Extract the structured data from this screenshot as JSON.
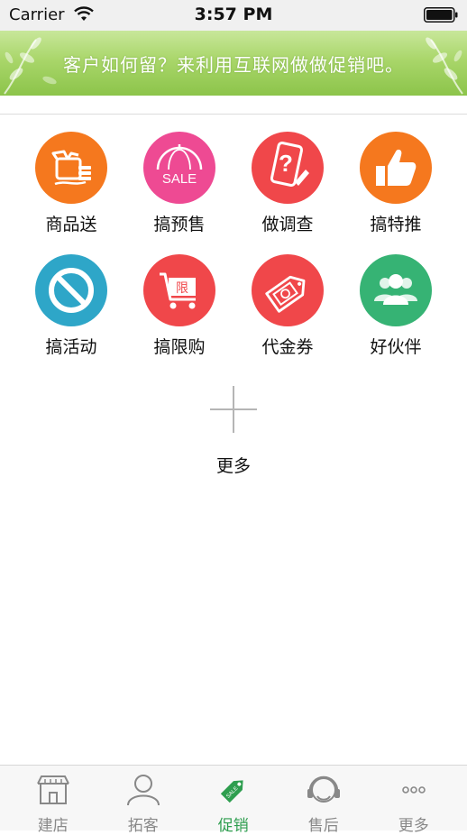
{
  "status_bar": {
    "carrier": "Carrier",
    "time": "3:57 PM"
  },
  "banner": {
    "text": "客户如何留？来利用互联网做做促销吧。"
  },
  "grid": [
    {
      "label": "商品送",
      "icon": "gift-box-icon",
      "color": "#F5781E"
    },
    {
      "label": "搞预售",
      "icon": "sale-umbrella-icon",
      "color": "#EE4A93"
    },
    {
      "label": "做调查",
      "icon": "survey-phone-icon",
      "color": "#F0474A"
    },
    {
      "label": "搞特推",
      "icon": "thumbs-up-icon",
      "color": "#F5781E"
    },
    {
      "label": "搞活动",
      "icon": "no-sign-icon",
      "color": "#2EA6C8"
    },
    {
      "label": "搞限购",
      "icon": "limit-cart-icon",
      "color": "#F0474A"
    },
    {
      "label": "代金券",
      "icon": "voucher-tag-icon",
      "color": "#F0474A"
    },
    {
      "label": "好伙伴",
      "icon": "partners-group-icon",
      "color": "#36B374"
    }
  ],
  "cart_badge": "限",
  "sale_text": "SALE",
  "more": {
    "label": "更多"
  },
  "tabbar": {
    "tabs": [
      {
        "label": "建店",
        "icon": "shop-icon",
        "active": false
      },
      {
        "label": "拓客",
        "icon": "user-icon",
        "active": false
      },
      {
        "label": "促销",
        "icon": "sale-tag-icon",
        "active": true
      },
      {
        "label": "售后",
        "icon": "headset-icon",
        "active": false
      },
      {
        "label": "更多",
        "icon": "ellipsis-icon",
        "active": false
      }
    ],
    "active_color": "#2E9E4F",
    "inactive_color": "#888888"
  }
}
